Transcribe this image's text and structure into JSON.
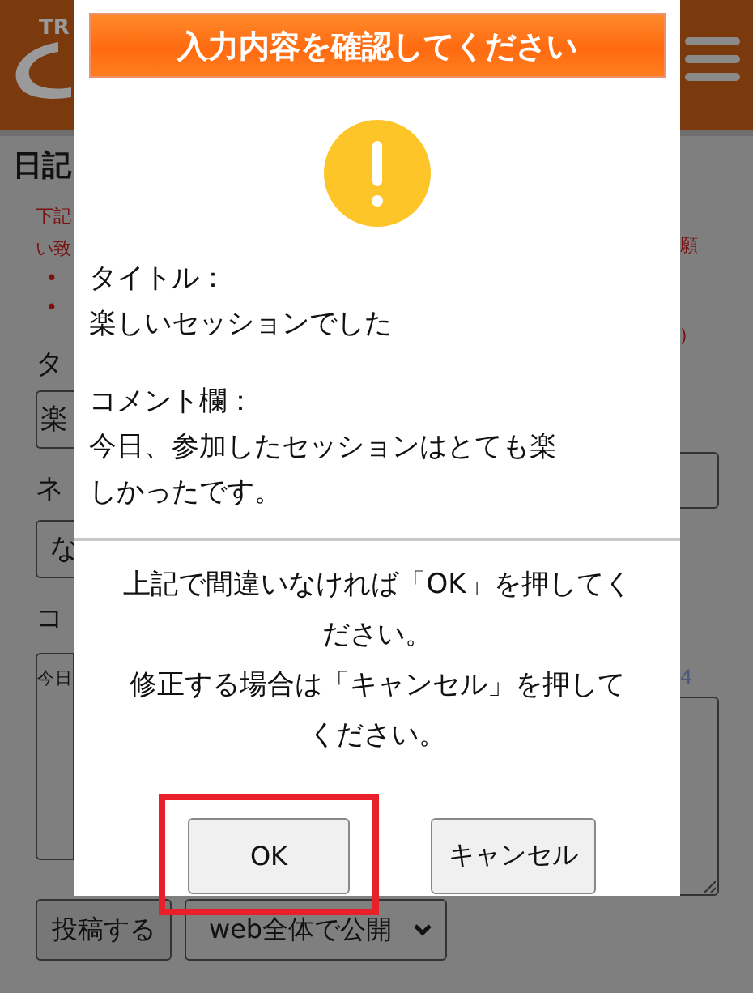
{
  "header": {
    "logo_text": "TR"
  },
  "page": {
    "title": "日記",
    "notice_left": [
      "下記",
      "い致"
    ],
    "notice_right": [
      "願",
      ")"
    ],
    "bullets": [
      "•",
      "•"
    ],
    "title_label": "タ",
    "title_value": "楽",
    "topic_label": "ネ",
    "topic_value": "な",
    "comment_label": "コ",
    "comment_value": "今日",
    "counter": "4"
  },
  "footer": {
    "submit": "投稿する",
    "visibility": "web全体で公開"
  },
  "dialog": {
    "title": "入力内容を確認してください",
    "fields": [
      {
        "label": "タイトル：",
        "value": [
          "楽しいセッションでした"
        ]
      },
      {
        "label": "コメント欄：",
        "value": [
          "今日、参加したセッションはとても楽",
          "しかったです。"
        ]
      }
    ],
    "message": [
      "上記で間違いなければ「OK」を押してください。",
      "修正する場合は「キャンセル」を押してください。"
    ],
    "buttons": [
      {
        "label": "OK",
        "highlighted": true
      },
      {
        "label": "キャンセル",
        "highlighted": false
      }
    ]
  }
}
